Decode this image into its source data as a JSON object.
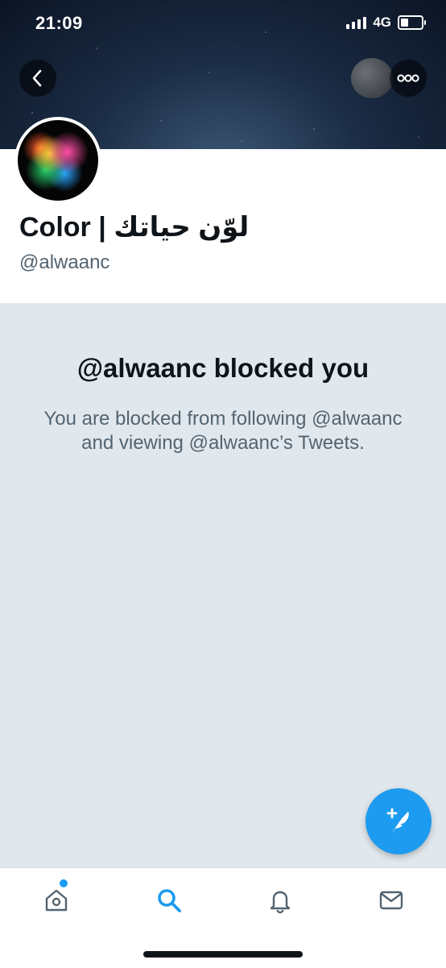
{
  "status_bar": {
    "time": "21:09",
    "network": "4G"
  },
  "profile": {
    "display_name": "Color | لوّن حياتك",
    "handle": "@alwaanc"
  },
  "blocked": {
    "title": "@alwaanc blocked you",
    "message": "You are blocked from following @alwaanc and viewing @alwaanc’s Tweets."
  },
  "icons": {
    "back": "chevron-left-icon",
    "more": "more-horizontal-icon",
    "compose": "compose-tweet-icon",
    "home": "home-icon",
    "search": "search-icon",
    "notifications": "bell-icon",
    "messages": "envelope-icon"
  },
  "colors": {
    "accent": "#1d9bf0",
    "blocked_background": "#e1e8ed",
    "secondary_text": "#536471"
  },
  "tabbar": {
    "active": "search",
    "home_has_badge": true
  }
}
